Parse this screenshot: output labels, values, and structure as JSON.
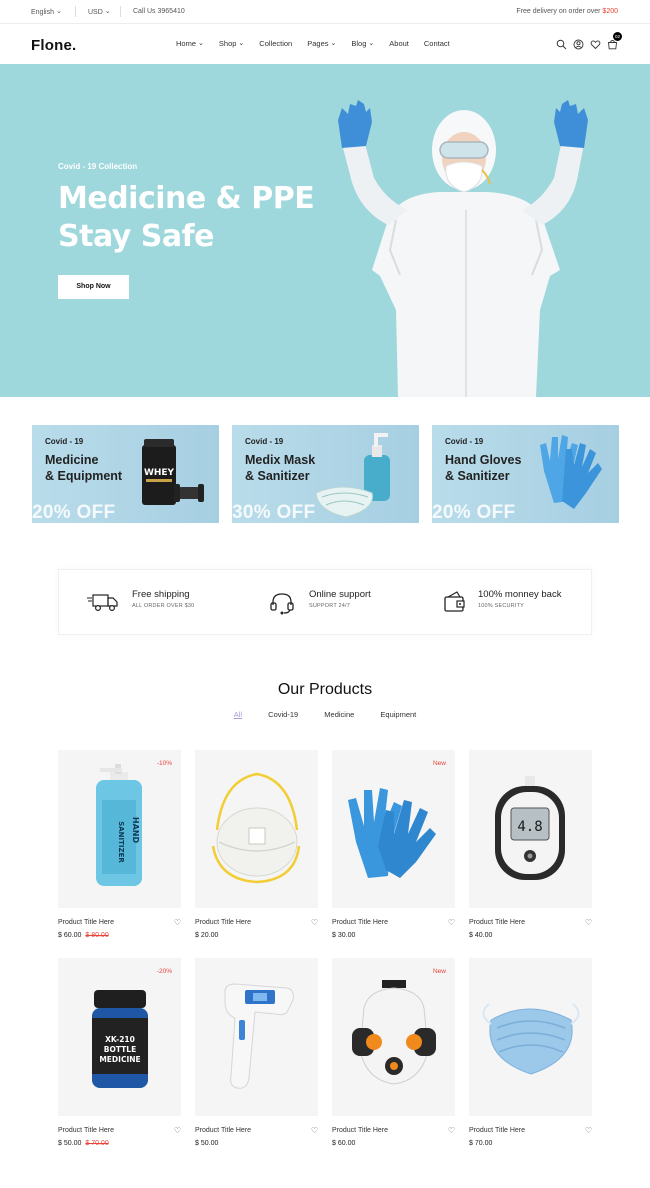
{
  "topbar": {
    "language": "English",
    "currency": "USD",
    "phone": "Call Us 3965410",
    "delivery_text": "Free delivery on order over",
    "delivery_amount": "$200"
  },
  "header": {
    "logo": "Flone.",
    "nav": [
      "Home",
      "Shop",
      "Collection",
      "Pages",
      "Blog",
      "About",
      "Contact"
    ],
    "cart_count": "02"
  },
  "hero": {
    "subtitle": "Covid - 19 Collection",
    "title_line1": "Medicine & PPE",
    "title_line2": "Stay Safe",
    "button": "Shop Now"
  },
  "banners": [
    {
      "sub": "Covid - 19",
      "title": "Medicine\n& Equipment",
      "off": "20% OFF",
      "product_label": "WHEY"
    },
    {
      "sub": "Covid - 19",
      "title": "Medix Mask\n& Sanitizer",
      "off": "30% OFF"
    },
    {
      "sub": "Covid - 19",
      "title": "Hand Gloves\n& Sanitizer",
      "off": "20% OFF"
    }
  ],
  "features": [
    {
      "title": "Free shipping",
      "desc": "ALL ORDER OVER $30",
      "icon": "truck-icon"
    },
    {
      "title": "Online support",
      "desc": "SUPPORT 24/7",
      "icon": "headset-icon"
    },
    {
      "title": "100% monney back",
      "desc": "100% SECURITY",
      "icon": "wallet-icon"
    }
  ],
  "products_section": {
    "title": "Our Products",
    "tabs": [
      "All",
      "Covid-19",
      "Medicine",
      "Equipment"
    ]
  },
  "products": [
    {
      "name": "Product Title Here",
      "price": "$ 60.00",
      "old_price": "$ 80.00",
      "badge": "-10%",
      "image": "hand-sanitizer",
      "label_top": "HAND",
      "label_bottom": "SANITIZER"
    },
    {
      "name": "Product Title Here",
      "price": "$ 20.00",
      "old_price": "",
      "badge": "",
      "image": "n95-mask"
    },
    {
      "name": "Product Title Here",
      "price": "$ 30.00",
      "old_price": "",
      "badge": "New",
      "image": "blue-gloves"
    },
    {
      "name": "Product Title Here",
      "price": "$ 40.00",
      "old_price": "",
      "badge": "",
      "image": "glucometer",
      "screen": "4.8"
    },
    {
      "name": "Product Title Here",
      "price": "$ 50.00",
      "old_price": "$ 70.00",
      "badge": "-20%",
      "image": "medicine-bottle",
      "label_lines": [
        "XK-210",
        "BOTTLE",
        "MEDICINE"
      ]
    },
    {
      "name": "Product Title Here",
      "price": "$ 50.00",
      "old_price": "",
      "badge": "",
      "image": "thermometer"
    },
    {
      "name": "Product Title Here",
      "price": "$ 60.00",
      "old_price": "",
      "badge": "New",
      "image": "respirator"
    },
    {
      "name": "Product Title Here",
      "price": "$ 70.00",
      "old_price": "",
      "badge": "",
      "image": "surgical-mask"
    }
  ]
}
